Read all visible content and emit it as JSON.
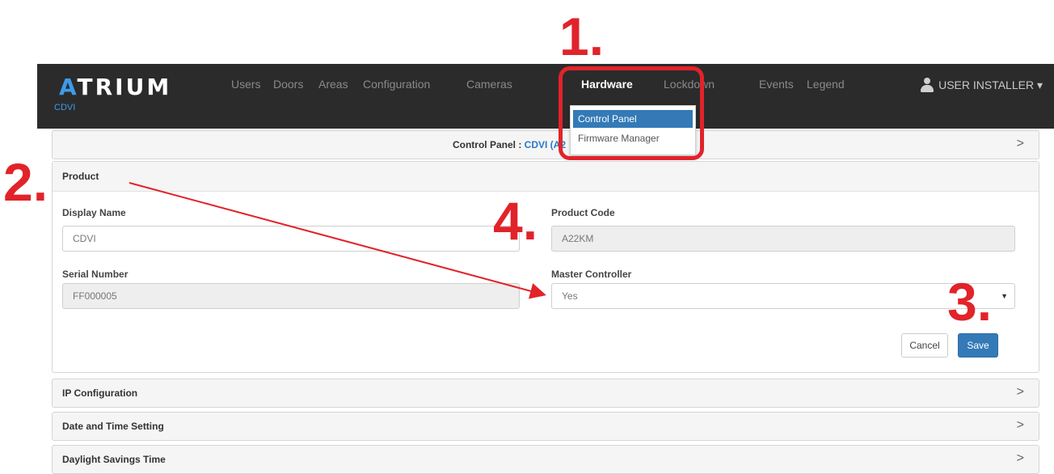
{
  "nav": {
    "logo_a": "A",
    "logo_rest": "TRIUM",
    "company": "CDVI",
    "items": [
      "Users",
      "Doors",
      "Areas",
      "Configuration",
      "Cameras",
      "Hardware",
      "Lockdown",
      "Events",
      "Legend"
    ],
    "active_item": "Hardware",
    "user_label": "USER INSTALLER ▾"
  },
  "dropdown": {
    "items": [
      "Control Panel",
      "Firmware Manager"
    ],
    "selected": "Control Panel"
  },
  "control_panel_bar": {
    "title_prefix": "Control Panel : ",
    "title_link": "CDVI (A2",
    "chevron": ">"
  },
  "product": {
    "heading": "Product",
    "display_name_label": "Display Name",
    "display_name_value": "CDVI",
    "product_code_label": "Product Code",
    "product_code_value": "A22KM",
    "serial_number_label": "Serial Number",
    "serial_number_value": "FF000005",
    "master_controller_label": "Master Controller",
    "master_controller_value": "Yes",
    "cancel_label": "Cancel",
    "save_label": "Save"
  },
  "sections": [
    {
      "label": "IP Configuration",
      "chevron": ">"
    },
    {
      "label": "Date and Time Setting",
      "chevron": ">"
    },
    {
      "label": "Daylight Savings Time",
      "chevron": ">"
    }
  ],
  "annotations": {
    "step1": "1.",
    "step2": "2.",
    "step3": "3.",
    "step4": "4.",
    "accent_color": "#e1232a"
  }
}
